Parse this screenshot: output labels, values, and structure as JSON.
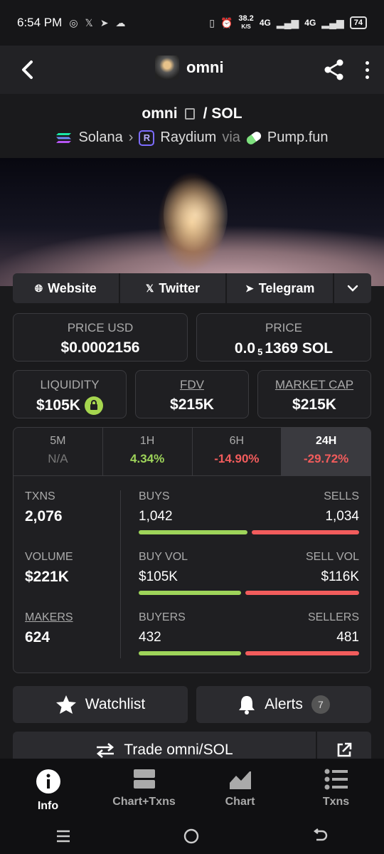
{
  "status_bar": {
    "time": "6:54 PM",
    "net_speed": "38.2",
    "net_unit": "K/S",
    "net1": "4G",
    "net2": "4G",
    "battery": "74"
  },
  "app_bar": {
    "title": "omni"
  },
  "pair": {
    "base": "omni",
    "separator": "/",
    "quote": "SOL",
    "chain": "Solana",
    "dex": "Raydium",
    "via": "via",
    "launchpad": "Pump.fun",
    "dex_icon_letter": "R"
  },
  "links": {
    "website": "Website",
    "twitter": "Twitter",
    "telegram": "Telegram"
  },
  "price": {
    "usd_label": "PRICE USD",
    "usd_value": "$0.0002156",
    "native_label": "PRICE",
    "native_prefix": "0.0",
    "native_zeros": "5",
    "native_rest": "1369 SOL"
  },
  "liquidity": {
    "label": "LIQUIDITY",
    "value": "$105K"
  },
  "fdv": {
    "label": "FDV",
    "value": "$215K"
  },
  "market_cap": {
    "label": "MARKET CAP",
    "value": "$215K"
  },
  "timeframes": [
    {
      "label": "5M",
      "value": "N/A",
      "tone": "na"
    },
    {
      "label": "1H",
      "value": "4.34%",
      "tone": "pos"
    },
    {
      "label": "6H",
      "value": "-14.90%",
      "tone": "neg"
    },
    {
      "label": "24H",
      "value": "-29.72%",
      "tone": "neg",
      "active": true
    }
  ],
  "txns": {
    "label": "TXNS",
    "value": "2,076",
    "left_label": "BUYS",
    "left_value": "1,042",
    "right_label": "SELLS",
    "right_value": "1,034",
    "buy_fraction": 0.502
  },
  "volume": {
    "label": "VOLUME",
    "value": "$221K",
    "left_label": "BUY VOL",
    "left_value": "$105K",
    "right_label": "SELL VOL",
    "right_value": "$116K",
    "buy_fraction": 0.475
  },
  "makers": {
    "label": "MAKERS",
    "value": "624",
    "left_label": "BUYERS",
    "left_value": "432",
    "right_label": "SELLERS",
    "right_value": "481",
    "buy_fraction": 0.473
  },
  "actions": {
    "watchlist": "Watchlist",
    "alerts": "Alerts",
    "alerts_count": "7",
    "trade": "Trade omni/SOL"
  },
  "bottom_nav": {
    "info": "Info",
    "chart_txns": "Chart+Txns",
    "chart": "Chart",
    "txns": "Txns"
  },
  "colors": {
    "positive": "#9ed45a",
    "negative": "#f25c5c",
    "background": "#1a1a1c"
  }
}
